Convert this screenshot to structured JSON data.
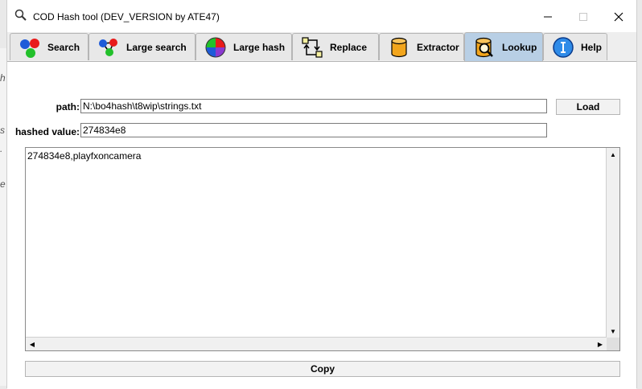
{
  "window": {
    "title": "COD Hash tool (DEV_VERSION by ATE47)"
  },
  "background": {
    "glyphs": [
      "h",
      "s",
      ".",
      "e"
    ]
  },
  "tabs": [
    {
      "label": "Search",
      "icon": "dots-icon"
    },
    {
      "label": "Large search",
      "icon": "graph-icon"
    },
    {
      "label": "Large hash",
      "icon": "color-wheel-icon"
    },
    {
      "label": "Replace",
      "icon": "replace-icon"
    },
    {
      "label": "Extractor",
      "icon": "barrel-icon"
    },
    {
      "label": "Lookup",
      "icon": "lookup-icon",
      "active": true
    },
    {
      "label": "Help",
      "icon": "info-icon"
    }
  ],
  "lookup": {
    "path_label": "path:",
    "path_value": "N:\\bo4hash\\t8wip\\strings.txt",
    "load_label": "Load",
    "hashed_label": "hashed value:",
    "hashed_value": "274834e8",
    "output_text": "274834e8,playfxoncamera",
    "copy_label": "Copy"
  },
  "colors": {
    "active_tab": "#b8cfe5",
    "tab_bg": "#e8e8e8"
  }
}
